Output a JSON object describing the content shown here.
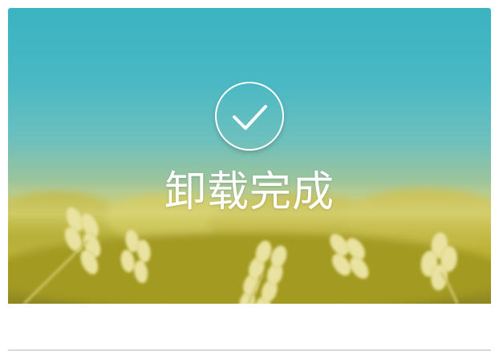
{
  "window": {
    "status_title": "卸载完成"
  },
  "icons": {
    "status_icon": "checkmark-circle-icon"
  },
  "colors": {
    "sky_top": "#3bb3c2",
    "wheat": "#c4bf4a",
    "text": "#ffffff"
  }
}
